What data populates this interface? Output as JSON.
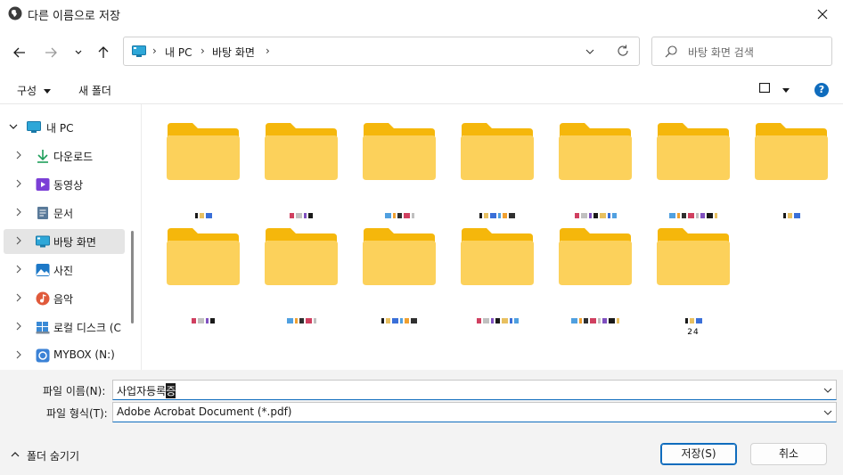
{
  "window": {
    "title": "다른 이름으로 저장",
    "close_icon": "close-icon",
    "app_icon": "globe-icon"
  },
  "nav": {
    "back_icon": "arrow-left-icon",
    "forward_icon": "arrow-right-icon",
    "recent_icon": "chevron-down-icon",
    "up_icon": "arrow-up-icon",
    "breadcrumb": [
      "내 PC",
      "바탕 화면"
    ],
    "refresh_icon": "refresh-icon",
    "search_placeholder": "바탕 화면 검색"
  },
  "commands": {
    "organize": "구성",
    "new_folder": "새 폴더"
  },
  "sidebar": {
    "items": [
      {
        "label": "내 PC",
        "icon": "pc-icon",
        "expanded": true
      },
      {
        "label": "다운로드",
        "icon": "download-icon"
      },
      {
        "label": "동영상",
        "icon": "video-icon"
      },
      {
        "label": "문서",
        "icon": "document-icon"
      },
      {
        "label": "바탕 화면",
        "icon": "desktop-icon",
        "selected": true
      },
      {
        "label": "사진",
        "icon": "picture-icon"
      },
      {
        "label": "음악",
        "icon": "music-icon"
      },
      {
        "label": "로컬 디스크 (C",
        "icon": "drive-icon"
      },
      {
        "label": "MYBOX (N:)",
        "icon": "cloud-drive-icon"
      }
    ]
  },
  "folders": {
    "count": 13,
    "last_label_suffix": "24"
  },
  "form": {
    "filename_label": "파일 이름(N):",
    "filename_value": "사업자등록",
    "filename_cursor_char": "증",
    "filetype_label": "파일 형식(T):",
    "filetype_value": "Adobe Acrobat Document (*.pdf)"
  },
  "footer": {
    "hide_folders": "폴더 숨기기",
    "save": "저장(S)",
    "cancel": "취소"
  },
  "colors": {
    "accent": "#0f6cbd",
    "folder": "#fcd15b",
    "folder_dark": "#f5b70b"
  }
}
